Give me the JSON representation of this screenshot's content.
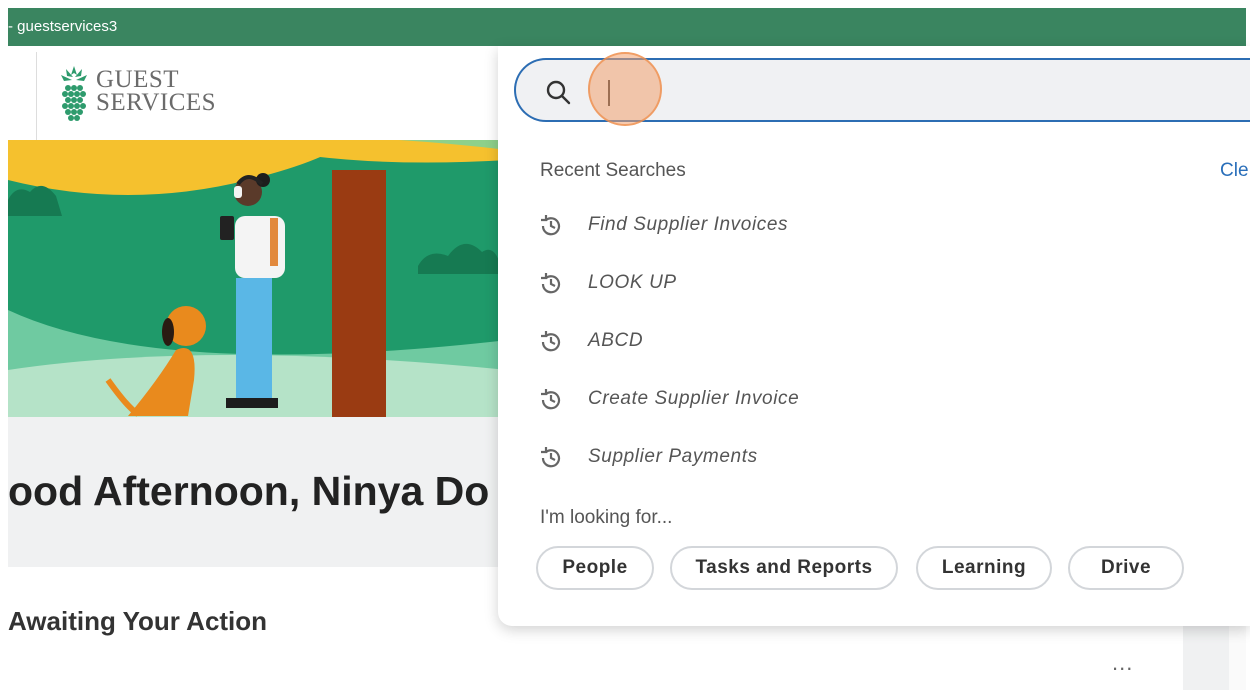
{
  "window": {
    "title_fragment": "- guestservices3"
  },
  "logo": {
    "line1": "GUEST",
    "line2": "SERVICES"
  },
  "home": {
    "greeting": "ood Afternoon, Ninya Do",
    "awaiting_title": "Awaiting Your Action",
    "more_label": "..."
  },
  "search": {
    "value": "",
    "placeholder": "",
    "recent_label": "Recent Searches",
    "clear_label": "Cle",
    "recent": [
      "Find Supplier Invoices",
      "LOOK UP",
      "ABCD",
      "Create Supplier Invoice",
      "Supplier Payments"
    ],
    "looking_for_label": "I'm looking for...",
    "categories": [
      "People",
      "Tasks and Reports",
      "Learning",
      "Drive"
    ]
  },
  "icons": {
    "search": "search-icon",
    "history": "history-icon",
    "logo": "pineapple-logo-icon"
  },
  "colors": {
    "topbar": "#3a8560",
    "search_border": "#2c6db3",
    "link": "#2a6fba",
    "hero_green": "#1f9a6a",
    "hero_yellow": "#f5c12e"
  }
}
